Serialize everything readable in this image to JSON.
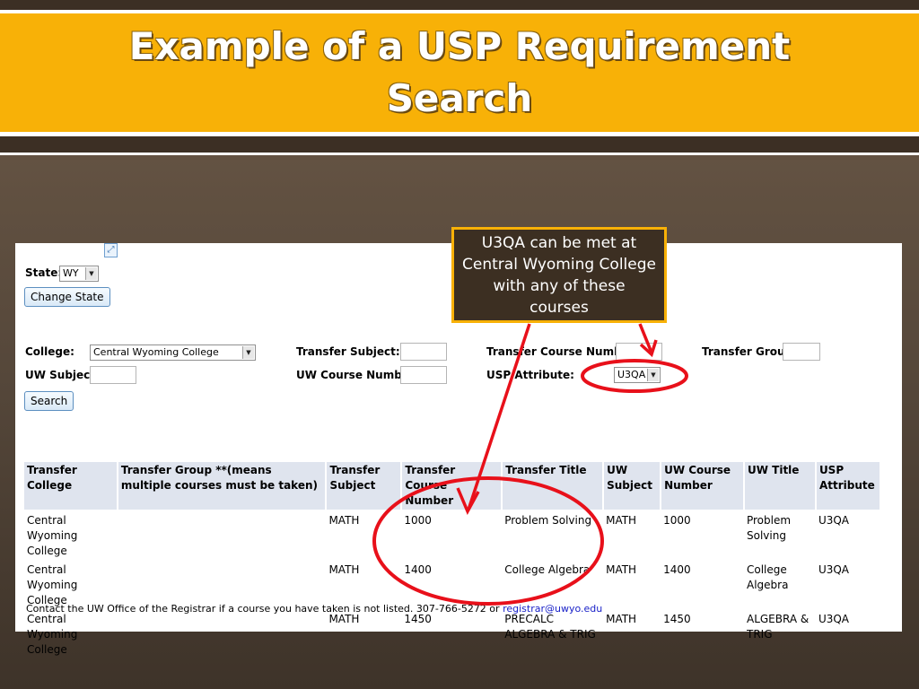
{
  "slide": {
    "title_line1": "Example of a USP Requirement",
    "title_line2": "Search",
    "colors": {
      "title_bar": "#f8b107",
      "annotation": "#e8101a",
      "callout_bg": "#3c2f22"
    }
  },
  "callout": {
    "text": "U3QA can be met at Central Wyoming College with any of these courses"
  },
  "form": {
    "corner_icon": "broken-image-icon",
    "state_label": "State:",
    "state_value": "WY",
    "change_state_label": "Change State",
    "college_label": "College:",
    "college_value": "Central Wyoming College",
    "transfer_subject_label": "Transfer Subject:",
    "transfer_course_number_label": "Transfer Course Number:",
    "transfer_group_label": "Transfer Group:",
    "uw_subject_label": "UW Subject:",
    "uw_course_number_label": "UW Course Number:",
    "usp_attribute_label": "USP Attribute:",
    "usp_attribute_value": "U3QA",
    "search_label": "Search"
  },
  "results": {
    "headers": [
      "Transfer College",
      "Transfer Group **(means multiple courses must be taken)",
      "Transfer Subject",
      "Transfer Course Number",
      "Transfer Title",
      "UW Subject",
      "UW Course Number",
      "UW Title",
      "USP Attribute"
    ],
    "rows": [
      [
        "Central Wyoming College",
        "",
        "MATH",
        "1000",
        "Problem Solving",
        "MATH",
        "1000",
        "Problem Solving",
        "U3QA"
      ],
      [
        "Central Wyoming College",
        "",
        "MATH",
        "1400",
        "College Algebra",
        "MATH",
        "1400",
        "College Algebra",
        "U3QA"
      ],
      [
        "Central Wyoming College",
        "",
        "MATH",
        "1450",
        "PRECALC ALGEBRA & TRIG",
        "MATH",
        "1450",
        "ALGEBRA & TRIG",
        "U3QA"
      ]
    ]
  },
  "footer": {
    "text": "Contact the UW Office of the Registrar if a course you have taken is not listed. 307-766-5272 or ",
    "email": "registrar@uwyo.edu"
  }
}
